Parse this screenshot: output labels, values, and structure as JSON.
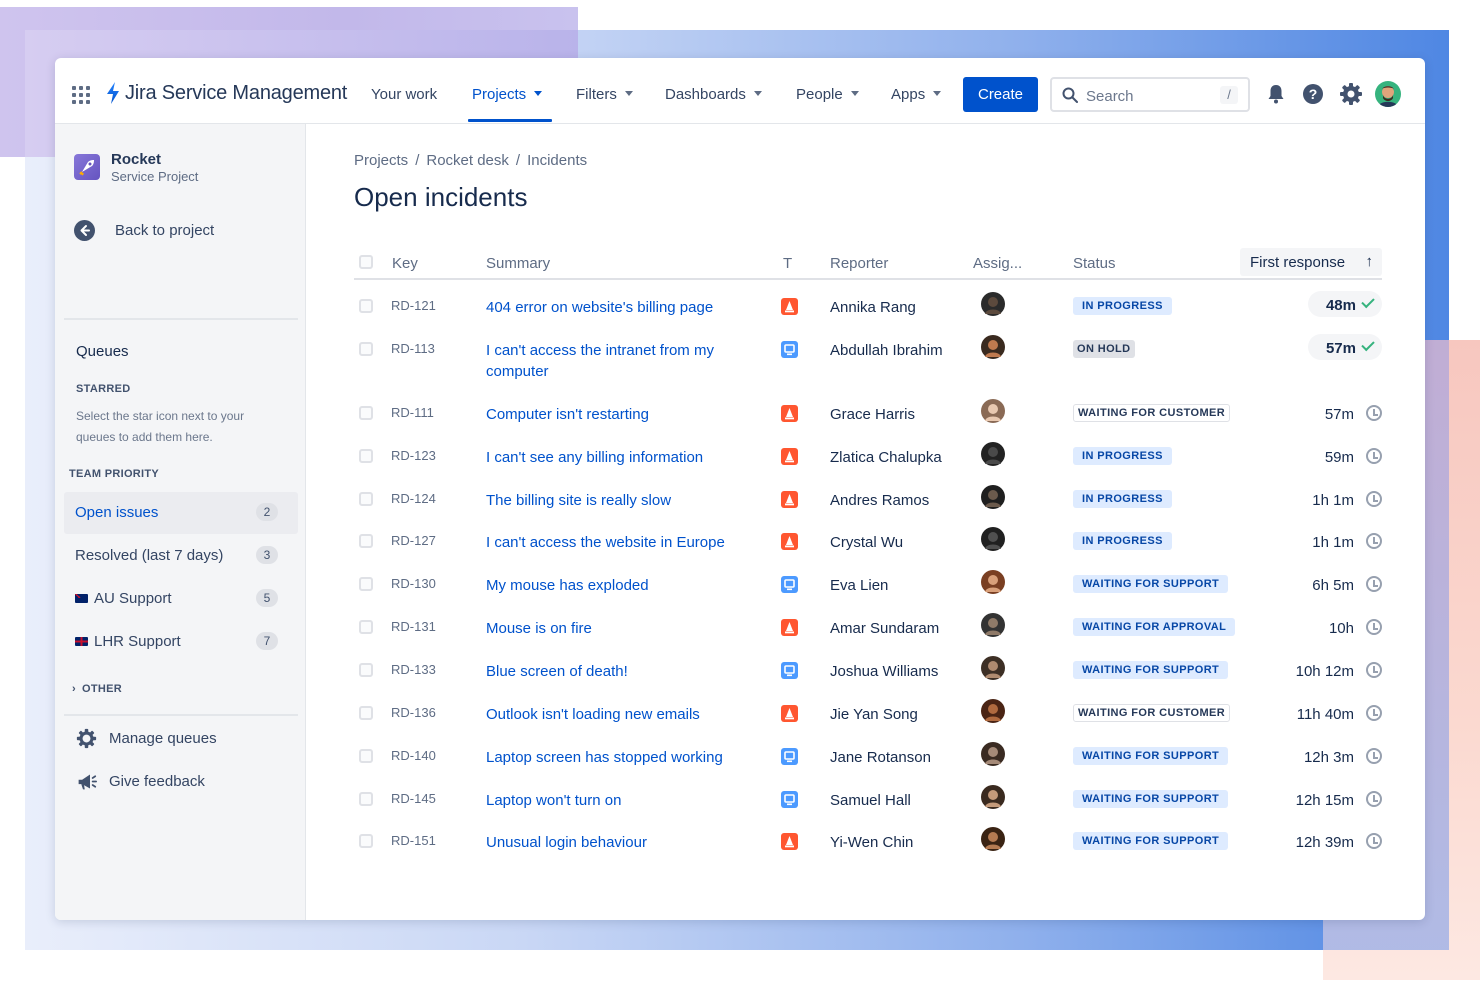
{
  "app": {
    "product_name": "Jira Service Management"
  },
  "nav": {
    "items": [
      {
        "label": "Your work",
        "dropdown": false,
        "active": false
      },
      {
        "label": "Projects",
        "dropdown": true,
        "active": true
      },
      {
        "label": "Filters",
        "dropdown": true,
        "active": false
      },
      {
        "label": "Dashboards",
        "dropdown": true,
        "active": false
      },
      {
        "label": "People",
        "dropdown": true,
        "active": false
      },
      {
        "label": "Apps",
        "dropdown": true,
        "active": false
      }
    ],
    "create_label": "Create",
    "search_placeholder": "Search",
    "search_shortcut": "/",
    "icons": [
      "notification-bell-icon",
      "help-icon",
      "settings-gear-icon",
      "user-avatar"
    ]
  },
  "sidebar": {
    "project_name": "Rocket",
    "project_type": "Service Project",
    "back_label": "Back to project",
    "queues_heading": "Queues",
    "starred_heading": "STARRED",
    "starred_help": "Select the star icon next to your queues to add them here.",
    "team_priority_heading": "TEAM PRIORITY",
    "queues": [
      {
        "label": "Open issues",
        "count": "2",
        "selected": true,
        "flag": ""
      },
      {
        "label": "Resolved (last 7 days)",
        "count": "3",
        "selected": false,
        "flag": ""
      },
      {
        "label": "AU Support",
        "count": "5",
        "selected": false,
        "flag": "au"
      },
      {
        "label": "LHR Support",
        "count": "7",
        "selected": false,
        "flag": "uk"
      }
    ],
    "other_heading": "OTHER",
    "manage_queues_label": "Manage queues",
    "give_feedback_label": "Give feedback"
  },
  "breadcrumb": [
    "Projects",
    "Rocket desk",
    "Incidents"
  ],
  "breadcrumb_separator": "/",
  "page_title": "Open incidents",
  "table": {
    "columns": {
      "key": "Key",
      "summary": "Summary",
      "type": "T",
      "reporter": "Reporter",
      "assignee": "Assig...",
      "status": "Status",
      "first_response": "First response"
    },
    "sort_indicator": "↑",
    "rows": [
      {
        "key": "RD-121",
        "summary": "404 error on website's billing page",
        "type": "incident",
        "reporter": "Annika Rang",
        "status": "IN PROGRESS",
        "status_kind": "inprogress",
        "time": "48m",
        "met": true
      },
      {
        "key": "RD-113",
        "summary": "I can't access the intranet from my computer",
        "type": "service",
        "reporter": "Abdullah Ibrahim",
        "status": "ON HOLD",
        "status_kind": "onhold",
        "time": "57m",
        "met": true
      },
      {
        "key": "RD-111",
        "summary": "Computer isn't restarting",
        "type": "incident",
        "reporter": "Grace Harris",
        "status": "WAITING FOR CUSTOMER",
        "status_kind": "waitcust",
        "time": "57m",
        "met": false
      },
      {
        "key": "RD-123",
        "summary": "I can't see any billing information",
        "type": "incident",
        "reporter": "Zlatica Chalupka",
        "status": "IN PROGRESS",
        "status_kind": "inprogress",
        "time": "59m",
        "met": false
      },
      {
        "key": "RD-124",
        "summary": "The billing site is really slow",
        "type": "incident",
        "reporter": "Andres Ramos",
        "status": "IN PROGRESS",
        "status_kind": "inprogress",
        "time": "1h 1m",
        "met": false
      },
      {
        "key": "RD-127",
        "summary": "I can't access the website in Europe",
        "type": "incident",
        "reporter": "Crystal Wu",
        "status": "IN PROGRESS",
        "status_kind": "inprogress",
        "time": "1h 1m",
        "met": false
      },
      {
        "key": "RD-130",
        "summary": "My mouse has exploded",
        "type": "service",
        "reporter": "Eva Lien",
        "status": "WAITING FOR SUPPORT",
        "status_kind": "waitsup",
        "time": "6h 5m",
        "met": false
      },
      {
        "key": "RD-131",
        "summary": "Mouse is on fire",
        "type": "incident",
        "reporter": "Amar Sundaram",
        "status": "WAITING FOR APPROVAL",
        "status_kind": "waitsup",
        "time": "10h",
        "met": false
      },
      {
        "key": "RD-133",
        "summary": "Blue screen of death!",
        "type": "service",
        "reporter": "Joshua Williams",
        "status": "WAITING FOR SUPPORT",
        "status_kind": "waitsup",
        "time": "10h 12m",
        "met": false
      },
      {
        "key": "RD-136",
        "summary": "Outlook isn't loading new emails",
        "type": "incident",
        "reporter": "Jie Yan Song",
        "status": "WAITING FOR CUSTOMER",
        "status_kind": "waitcust",
        "time": "11h 40m",
        "met": false
      },
      {
        "key": "RD-140",
        "summary": "Laptop screen has stopped working",
        "type": "service",
        "reporter": "Jane Rotanson",
        "status": "WAITING FOR SUPPORT",
        "status_kind": "waitsup",
        "time": "12h 3m",
        "met": false
      },
      {
        "key": "RD-145",
        "summary": "Laptop won't turn on",
        "type": "service",
        "reporter": "Samuel Hall",
        "status": "WAITING FOR SUPPORT",
        "status_kind": "waitsup",
        "time": "12h 15m",
        "met": false
      },
      {
        "key": "RD-151",
        "summary": "Unusual login behaviour",
        "type": "incident",
        "reporter": "Yi-Wen Chin",
        "status": "WAITING FOR SUPPORT",
        "status_kind": "waitsup",
        "time": "12h 39m",
        "met": false
      }
    ]
  },
  "colors": {
    "brand_blue": "#0052cc",
    "incident": "#ff5630",
    "service_request": "#4c9aff",
    "sla_met": "#36b37e"
  }
}
